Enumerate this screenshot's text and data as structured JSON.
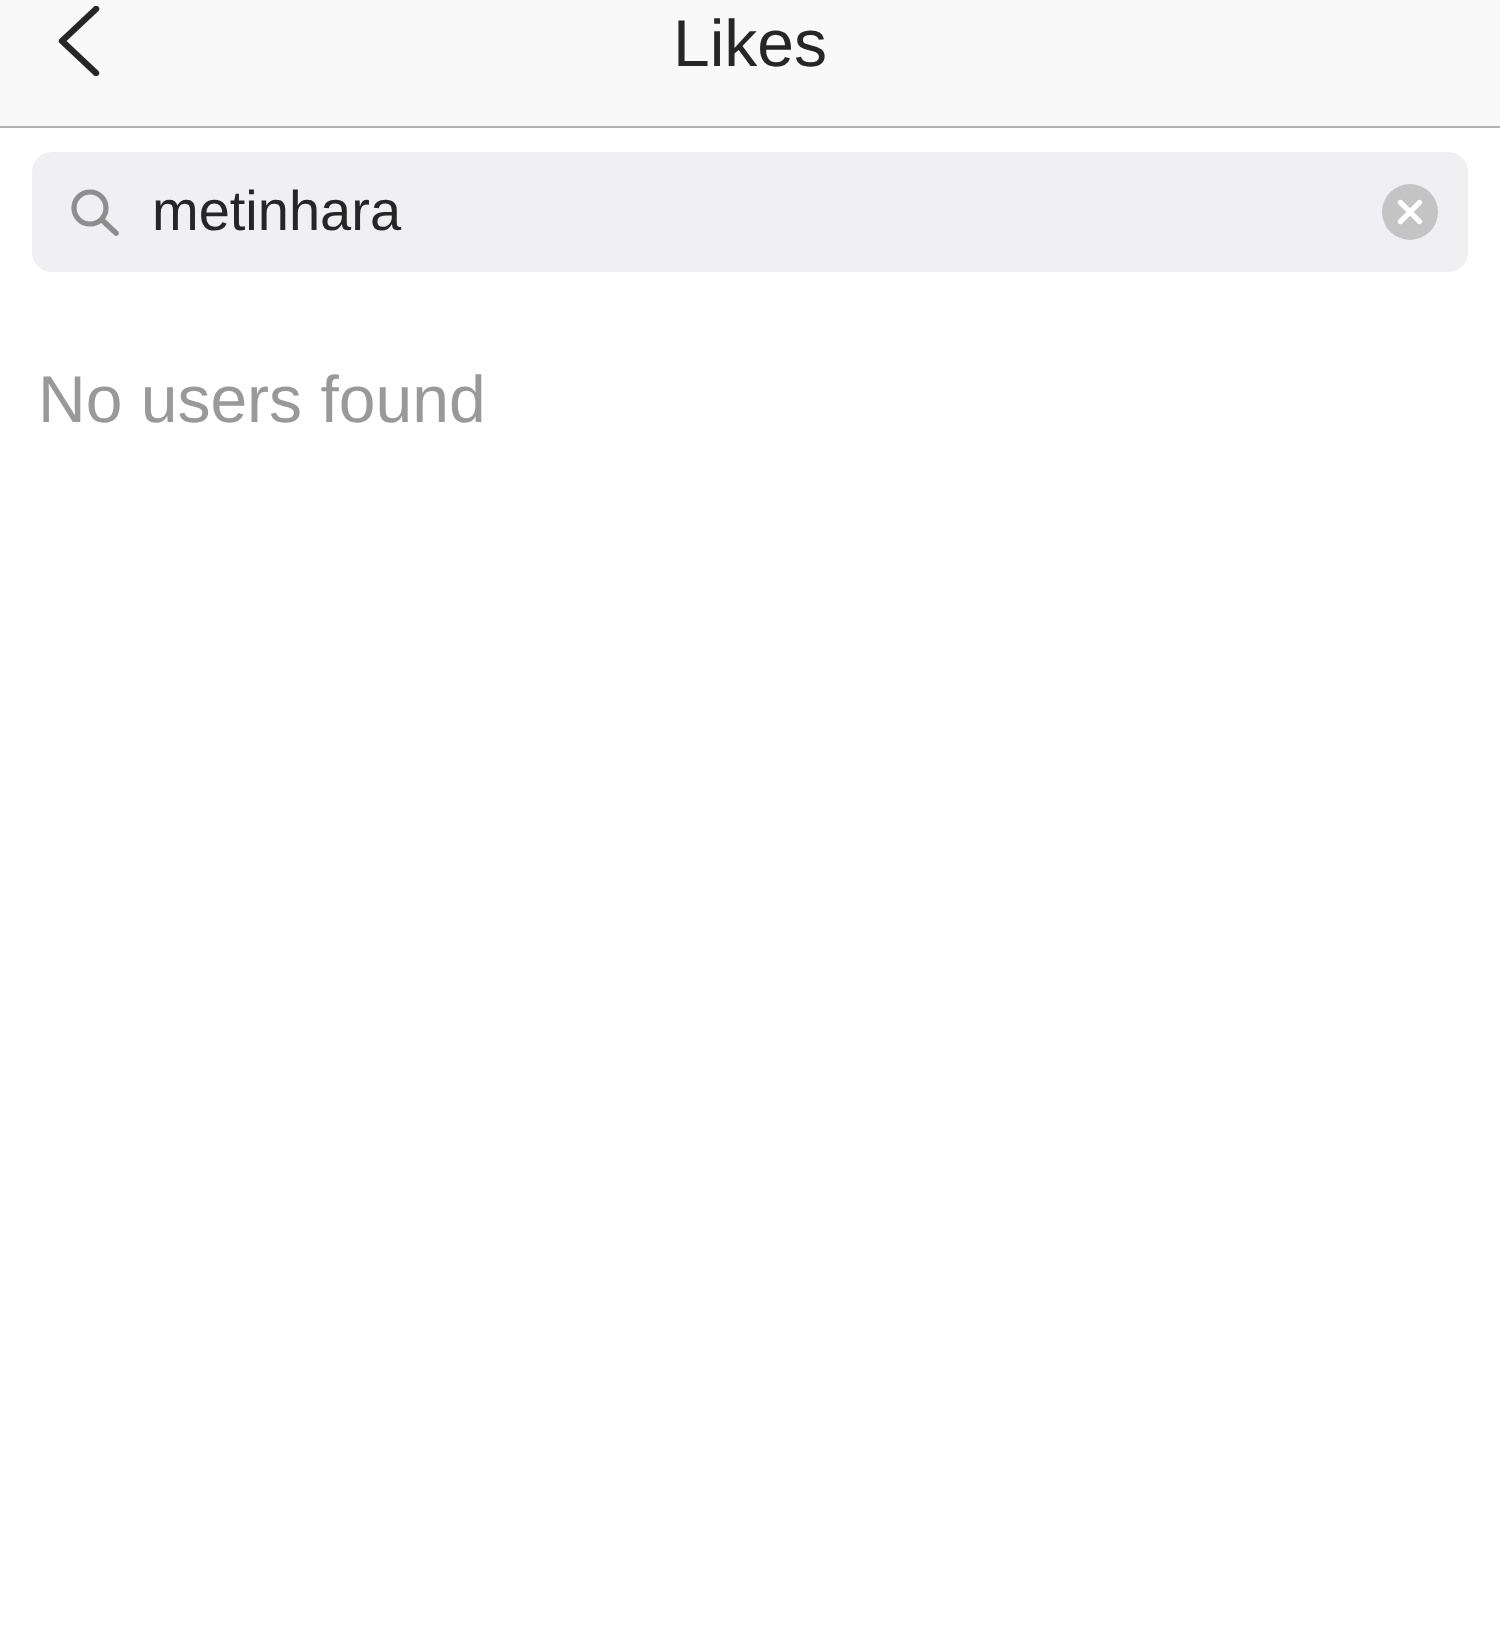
{
  "header": {
    "title": "Likes"
  },
  "search": {
    "value": "metinhara"
  },
  "results": {
    "empty_message": "No users found"
  }
}
